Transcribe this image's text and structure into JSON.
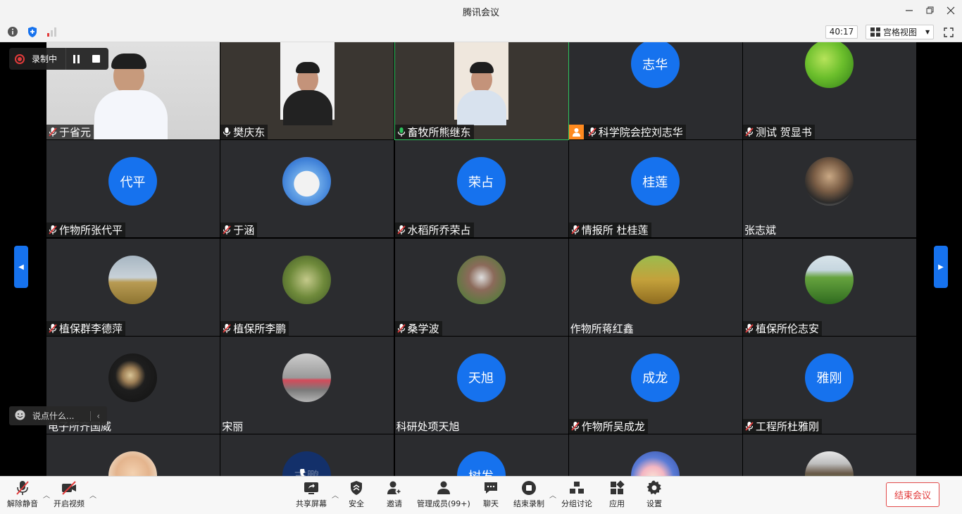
{
  "window": {
    "title": "腾讯会议"
  },
  "infobar": {
    "timer": "40:17",
    "layout_label": "宫格视图"
  },
  "recording": {
    "label": "录制中"
  },
  "chat": {
    "placeholder": "说点什么..."
  },
  "tiles": [
    {
      "name": "于省元",
      "kind": "video",
      "mic": "muted"
    },
    {
      "name": "樊庆东",
      "kind": "video",
      "mic": "on-white"
    },
    {
      "name": "畜牧所熊继东",
      "kind": "video",
      "mic": "on-green"
    },
    {
      "name": "科学院会控刘志华",
      "kind": "avatar",
      "avatar_text": "志华",
      "mic": "muted",
      "host": true
    },
    {
      "name": "测试 贺显书",
      "kind": "photo",
      "photo": "leaves",
      "mic": "muted"
    },
    {
      "name": "作物所张代平",
      "kind": "avatar",
      "avatar_text": "代平",
      "mic": "muted"
    },
    {
      "name": "于涵",
      "kind": "photo",
      "photo": "cartoon-cat",
      "mic": "muted"
    },
    {
      "name": "水稻所乔荣占",
      "kind": "avatar",
      "avatar_text": "荣占",
      "mic": "muted"
    },
    {
      "name": "情报所 杜桂莲",
      "kind": "avatar",
      "avatar_text": "桂莲",
      "mic": "muted"
    },
    {
      "name": "张志斌",
      "kind": "photo",
      "photo": "man-glasses",
      "mic": "none"
    },
    {
      "name": "植保群李德萍",
      "kind": "photo",
      "photo": "field-sky",
      "mic": "muted"
    },
    {
      "name": "植保所李鹏",
      "kind": "photo",
      "photo": "rice-plant",
      "mic": "muted"
    },
    {
      "name": "桑学波",
      "kind": "photo",
      "photo": "person-rocks",
      "mic": "muted"
    },
    {
      "name": "作物所蒋红鑫",
      "kind": "photo",
      "photo": "crop-field",
      "mic": "none"
    },
    {
      "name": "植保所伦志安",
      "kind": "photo",
      "photo": "green-field",
      "mic": "muted"
    },
    {
      "name": "电子所齐国威",
      "kind": "photo",
      "photo": "toy-figure",
      "mic": "none"
    },
    {
      "name": "宋丽",
      "kind": "photo",
      "photo": "beach-woman",
      "mic": "none"
    },
    {
      "name": "科研处项天旭",
      "kind": "avatar",
      "avatar_text": "天旭",
      "mic": "none"
    },
    {
      "name": "作物所吴成龙",
      "kind": "avatar",
      "avatar_text": "成龙",
      "mic": "muted"
    },
    {
      "name": "工程所杜雅刚",
      "kind": "avatar",
      "avatar_text": "雅刚",
      "mic": "muted"
    },
    {
      "name": "",
      "kind": "photo",
      "photo": "baby",
      "mic": "none"
    },
    {
      "name": "",
      "kind": "phone",
      "avatar_text": "志鹏",
      "mic": "none"
    },
    {
      "name": "",
      "kind": "avatar",
      "avatar_text": "树发",
      "mic": "none"
    },
    {
      "name": "",
      "kind": "photo",
      "photo": "anime-girl",
      "mic": "none"
    },
    {
      "name": "",
      "kind": "photo",
      "photo": "pagoda",
      "mic": "none"
    }
  ],
  "toolbar": {
    "mute": "解除静音",
    "video": "开启视频",
    "share": "共享屏幕",
    "security": "安全",
    "invite": "邀请",
    "members": "管理成员(99+)",
    "chat": "聊天",
    "stop_record": "结束录制",
    "breakout": "分组讨论",
    "apps": "应用",
    "settings": "设置",
    "end": "结束会议"
  },
  "colors": {
    "accent": "#1672ee",
    "danger": "#e23b3b",
    "tile_bg": "#2b2c2f"
  }
}
